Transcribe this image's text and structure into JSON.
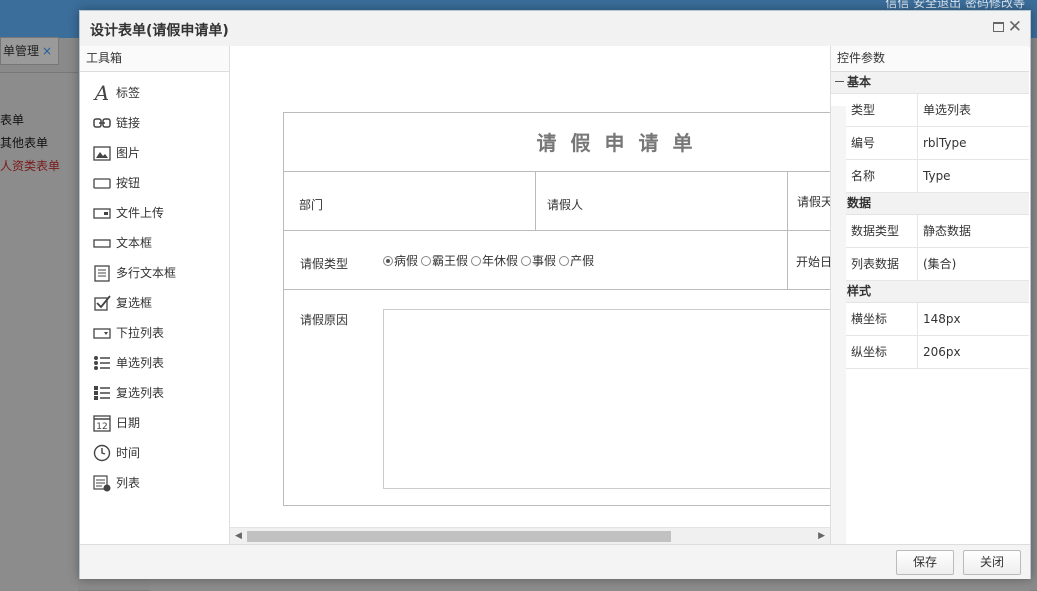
{
  "background": {
    "top_right_text": "信信   安全退出   密码修改等",
    "tab_label": "单管理",
    "tab_close": "×",
    "side_items": [
      "表单",
      "其他表单",
      "人资类表单"
    ]
  },
  "dialog": {
    "title": "设计表单(请假申请单)",
    "close_glyph": "✕"
  },
  "toolbox": {
    "header": "工具箱",
    "items": [
      {
        "label": "标签",
        "icon": "label-icon"
      },
      {
        "label": "链接",
        "icon": "link-icon"
      },
      {
        "label": "图片",
        "icon": "image-icon"
      },
      {
        "label": "按钮",
        "icon": "button-icon"
      },
      {
        "label": "文件上传",
        "icon": "file-upload-icon"
      },
      {
        "label": "文本框",
        "icon": "textbox-icon"
      },
      {
        "label": "多行文本框",
        "icon": "multiline-textbox-icon"
      },
      {
        "label": "复选框",
        "icon": "checkbox-icon"
      },
      {
        "label": "下拉列表",
        "icon": "dropdown-icon"
      },
      {
        "label": "单选列表",
        "icon": "radio-list-icon"
      },
      {
        "label": "复选列表",
        "icon": "checkbox-list-icon"
      },
      {
        "label": "日期",
        "icon": "calendar-icon"
      },
      {
        "label": "时间",
        "icon": "clock-icon"
      },
      {
        "label": "列表",
        "icon": "list-icon"
      }
    ]
  },
  "form": {
    "title": "请假申请单",
    "labels": {
      "department": "部门",
      "applicant": "请假人",
      "days": "请假天",
      "leave_type": "请假类型",
      "start_date": "开始日",
      "reason": "请假原因"
    },
    "leave_options": [
      {
        "label": "病假",
        "selected": true
      },
      {
        "label": "霸王假",
        "selected": false
      },
      {
        "label": "年休假",
        "selected": false
      },
      {
        "label": "事假",
        "selected": false
      },
      {
        "label": "产假",
        "selected": false
      }
    ]
  },
  "properties": {
    "header": "控件参数",
    "groups": {
      "basic": {
        "name": "基本",
        "rows": [
          {
            "key": "类型",
            "value": "单选列表"
          },
          {
            "key": "编号",
            "value": "rblType"
          },
          {
            "key": "名称",
            "value": "Type"
          }
        ]
      },
      "data": {
        "name": "数据",
        "rows": [
          {
            "key": "数据类型",
            "value": "静态数据"
          },
          {
            "key": "列表数据",
            "value": "(集合)"
          }
        ]
      },
      "style": {
        "name": "样式",
        "rows": [
          {
            "key": "横坐标",
            "value": "148px"
          },
          {
            "key": "纵坐标",
            "value": "206px"
          }
        ]
      }
    }
  },
  "footer": {
    "save_label": "保存",
    "close_label": "关闭"
  }
}
